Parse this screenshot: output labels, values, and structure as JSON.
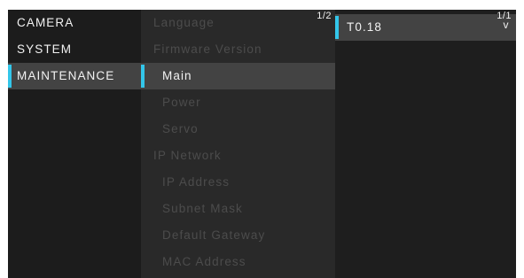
{
  "categories": [
    {
      "label": "CAMERA"
    },
    {
      "label": "SYSTEM"
    },
    {
      "label": "MAINTENANCE",
      "selected": true
    }
  ],
  "submenu": {
    "page": "1/2",
    "items": [
      {
        "label": "Language"
      },
      {
        "label": "Firmware Version"
      },
      {
        "label": "Main",
        "selected": true
      },
      {
        "label": "Power"
      },
      {
        "label": "Servo"
      },
      {
        "label": "IP Network"
      },
      {
        "label": "IP Address"
      },
      {
        "label": "Subnet Mask"
      },
      {
        "label": "Default Gateway"
      },
      {
        "label": "MAC Address"
      }
    ]
  },
  "value_panel": {
    "page": "1/1",
    "value": "T0.18",
    "arrow": "v"
  },
  "colors": {
    "cursor": "#33c6ea",
    "selected_background": "#434343",
    "dimmed_text": "#4c4c4c",
    "text": "#f2f2f2"
  }
}
